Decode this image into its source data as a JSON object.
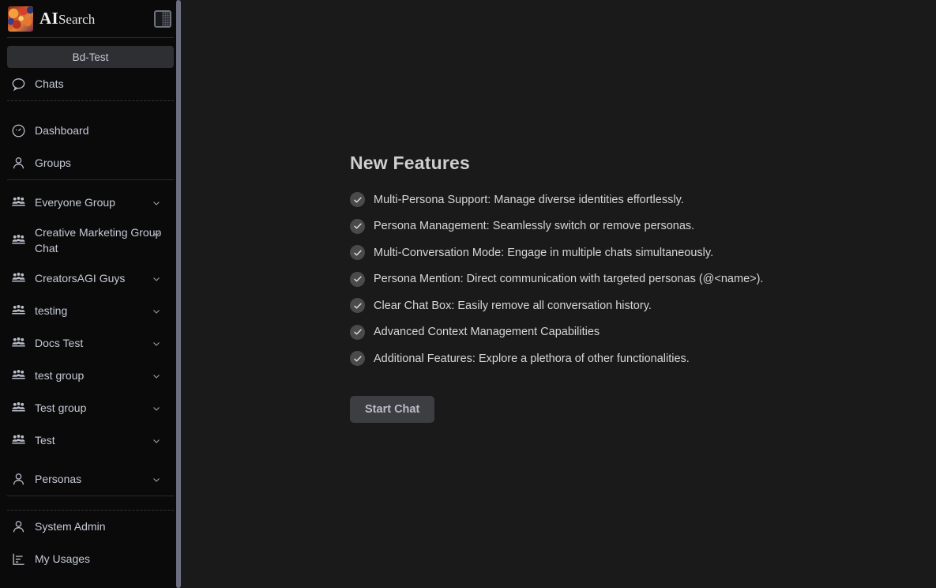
{
  "sidebar": {
    "brand": {
      "ai": "AI",
      "search": "Search",
      "logo_icon": "app-logo-image",
      "toggle_icon": "panel-toggle-icon"
    },
    "workspace_button": "Bd-Test",
    "chats": {
      "label": "Chats",
      "icon": "chat-bubble-icon"
    },
    "nav": [
      {
        "label": "Dashboard",
        "icon": "gauge-icon",
        "chevron": false
      },
      {
        "label": "Groups",
        "icon": "person-icon",
        "chevron": false
      }
    ],
    "groups": [
      {
        "label": "Everyone Group",
        "icon": "people-group-icon",
        "chevron": true,
        "wrap": false
      },
      {
        "label": "Creative Marketing Group Chat",
        "icon": "people-group-icon",
        "chevron": true,
        "wrap": true
      },
      {
        "label": "CreatorsAGI Guys",
        "icon": "people-group-icon",
        "chevron": true,
        "wrap": false
      },
      {
        "label": "testing",
        "icon": "people-group-icon",
        "chevron": true,
        "wrap": false
      },
      {
        "label": "Docs Test",
        "icon": "people-group-icon",
        "chevron": true,
        "wrap": false
      },
      {
        "label": "test group",
        "icon": "people-group-icon",
        "chevron": true,
        "wrap": false
      },
      {
        "label": "Test group",
        "icon": "people-group-icon",
        "chevron": true,
        "wrap": false
      },
      {
        "label": "Test",
        "icon": "people-group-icon",
        "chevron": true,
        "wrap": false
      }
    ],
    "personas": {
      "label": "Personas",
      "icon": "person-icon",
      "chevron": true
    },
    "footer": [
      {
        "label": "System Admin",
        "icon": "person-icon"
      },
      {
        "label": "My Usages",
        "icon": "bar-chart-icon"
      }
    ]
  },
  "main": {
    "title": "New Features",
    "features": [
      "Multi-Persona Support: Manage diverse identities effortlessly.",
      "Persona Management: Seamlessly switch or remove personas.",
      "Multi-Conversation Mode: Engage in multiple chats simultaneously.",
      "Persona Mention: Direct communication with targeted personas (@<name>).",
      "Clear Chat Box: Easily remove all conversation history.",
      "Advanced Context Management Capabilities",
      "Additional Features: Explore a plethora of other functionalities."
    ],
    "start_chat_label": "Start Chat"
  },
  "colors": {
    "sidebar_bg": "#0a0a0a",
    "main_bg": "#1a1a1a",
    "accent_text": "#c5cad6",
    "button_bg": "#3d3e42",
    "scrollbar": "#6b6f80"
  }
}
